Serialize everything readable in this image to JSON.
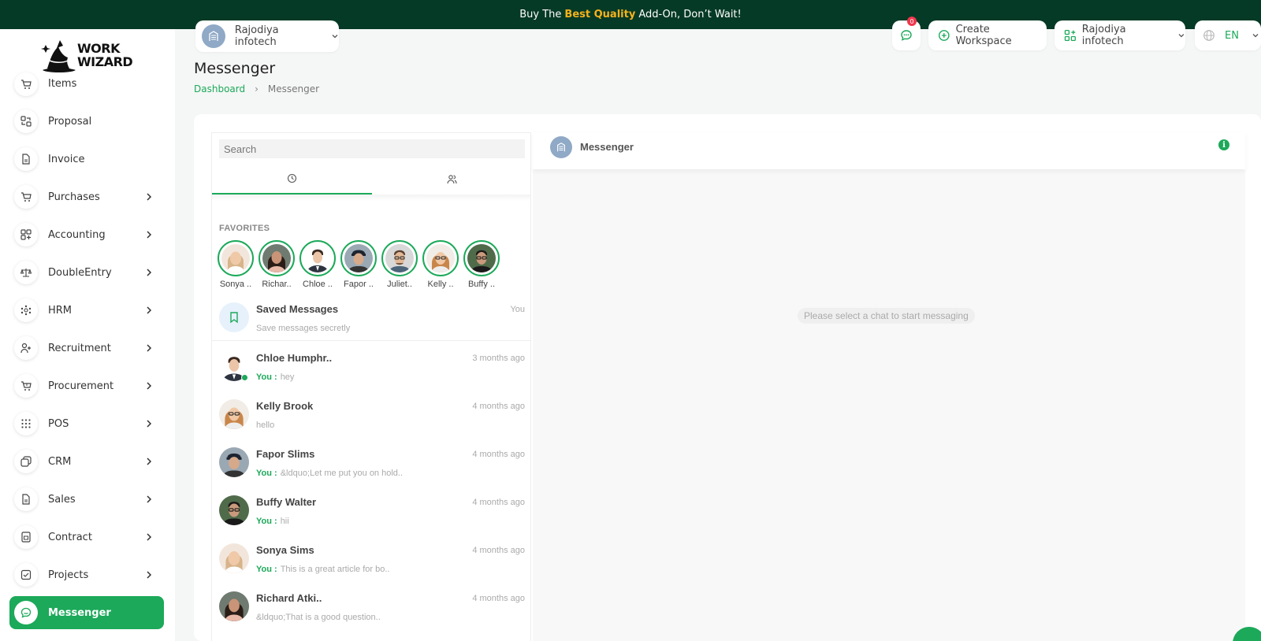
{
  "promo": {
    "before": "Buy The",
    "highlight": "Best Quality",
    "after": "Add-On, Don’t Wait!"
  },
  "logo": {
    "line1": "WORK",
    "line2": "WIZARD"
  },
  "workspace": {
    "name": "Rajodiya infotech"
  },
  "header": {
    "message_badge": "0",
    "create_workspace": "Create Workspace",
    "company": "Rajodiya infotech",
    "language": "EN"
  },
  "page": {
    "title": "Messenger",
    "breadcrumb": [
      "Dashboard",
      "Messenger"
    ]
  },
  "sidebar": {
    "items": [
      {
        "label": "Items",
        "icon": "cart-icon"
      },
      {
        "label": "Proposal",
        "icon": "proposal-icon"
      },
      {
        "label": "Invoice",
        "icon": "file-icon"
      },
      {
        "label": "Purchases",
        "icon": "cart-icon"
      },
      {
        "label": "Accounting",
        "icon": "grid-plus-icon"
      },
      {
        "label": "DoubleEntry",
        "icon": "scale-icon"
      },
      {
        "label": "HRM",
        "icon": "hrm-icon"
      },
      {
        "label": "Recruitment",
        "icon": "user-plus-icon"
      },
      {
        "label": "Procurement",
        "icon": "cart-icon"
      },
      {
        "label": "POS",
        "icon": "dots-grid-icon"
      },
      {
        "label": "CRM",
        "icon": "layers-icon"
      },
      {
        "label": "Sales",
        "icon": "file-icon"
      },
      {
        "label": "Contract",
        "icon": "contract-icon"
      },
      {
        "label": "Projects",
        "icon": "check-square-icon"
      },
      {
        "label": "Messenger",
        "icon": "chat-icon"
      }
    ]
  },
  "messenger": {
    "search_placeholder": "Search",
    "favorites_title": "FAVORITES",
    "favorites": [
      "Sonya ..",
      "Richar..",
      "Chloe ..",
      "Fapor ..",
      "Juliet..",
      "Kelly ..",
      "Buffy .."
    ],
    "saved": {
      "name": "Saved Messages",
      "time": "You",
      "message": "Save messages secretly"
    },
    "you_label": "You :",
    "conversations": [
      {
        "name": "Chloe Humphr..",
        "time": "3 months ago",
        "message": "hey",
        "from_you": true
      },
      {
        "name": "Kelly Brook",
        "time": "4 months ago",
        "message": "hello",
        "from_you": false
      },
      {
        "name": "Fapor Slims",
        "time": "4 months ago",
        "message": "&ldquo;Let me put you on hold..",
        "from_you": true
      },
      {
        "name": "Buffy Walter",
        "time": "4 months ago",
        "message": "hii",
        "from_you": true
      },
      {
        "name": "Sonya Sims",
        "time": "4 months ago",
        "message": "This is a great article for bo..",
        "from_you": true
      },
      {
        "name": "Richard Atki..",
        "time": "4 months ago",
        "message": "&ldquo;That is a good question..",
        "from_you": false
      }
    ],
    "chat_title": "Messenger",
    "empty_note": "Please select a chat to start messaging"
  },
  "colors": {
    "brand": "#1ca95a",
    "promo_bg": "#053a26",
    "promo_highlight": "#f6b21b"
  }
}
